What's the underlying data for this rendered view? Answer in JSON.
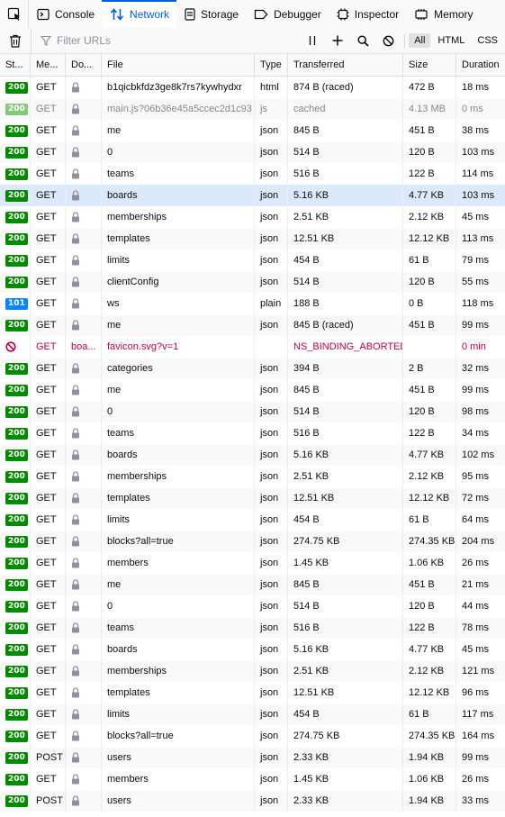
{
  "tabs": [
    {
      "label": "Console",
      "icon": "console-icon"
    },
    {
      "label": "Network",
      "icon": "network-icon",
      "active": true
    },
    {
      "label": "Storage",
      "icon": "storage-icon"
    },
    {
      "label": "Debugger",
      "icon": "debugger-icon"
    },
    {
      "label": "Inspector",
      "icon": "inspector-icon"
    },
    {
      "label": "Memory",
      "icon": "memory-icon"
    }
  ],
  "toolbar": {
    "filter_placeholder": "Filter URLs",
    "filter_types": [
      "All",
      "HTML",
      "CSS"
    ],
    "active_filter": "All"
  },
  "columns": [
    "St...",
    "Me...",
    "Do...",
    "File",
    "Type",
    "Transferred",
    "Size",
    "Duration"
  ],
  "requests": [
    {
      "status": "200",
      "method": "GET",
      "domain": "",
      "file": "b1qicbkfdz3ge8k7rs7kywhydxr",
      "type": "html",
      "transferred": "874 B (raced)",
      "size": "472 B",
      "duration": "18 ms"
    },
    {
      "status": "200",
      "method": "GET",
      "domain": "",
      "file": "main.js?06b36e45a5ccec2d1c93",
      "type": "js",
      "transferred": "cached",
      "size": "4.13 MB",
      "duration": "0 ms",
      "cached": true
    },
    {
      "status": "200",
      "method": "GET",
      "domain": "",
      "file": "me",
      "type": "json",
      "transferred": "845 B",
      "size": "451 B",
      "duration": "38 ms"
    },
    {
      "status": "200",
      "method": "GET",
      "domain": "",
      "file": "0",
      "type": "json",
      "transferred": "514 B",
      "size": "120 B",
      "duration": "103 ms"
    },
    {
      "status": "200",
      "method": "GET",
      "domain": "",
      "file": "teams",
      "type": "json",
      "transferred": "516 B",
      "size": "122 B",
      "duration": "114 ms"
    },
    {
      "status": "200",
      "method": "GET",
      "domain": "",
      "file": "boards",
      "type": "json",
      "transferred": "5.16 KB",
      "size": "4.77 KB",
      "duration": "103 ms",
      "selected": true
    },
    {
      "status": "200",
      "method": "GET",
      "domain": "",
      "file": "memberships",
      "type": "json",
      "transferred": "2.51 KB",
      "size": "2.12 KB",
      "duration": "45 ms"
    },
    {
      "status": "200",
      "method": "GET",
      "domain": "",
      "file": "templates",
      "type": "json",
      "transferred": "12.51 KB",
      "size": "12.12 KB",
      "duration": "113 ms"
    },
    {
      "status": "200",
      "method": "GET",
      "domain": "",
      "file": "limits",
      "type": "json",
      "transferred": "454 B",
      "size": "61 B",
      "duration": "79 ms"
    },
    {
      "status": "200",
      "method": "GET",
      "domain": "",
      "file": "clientConfig",
      "type": "json",
      "transferred": "514 B",
      "size": "120 B",
      "duration": "55 ms"
    },
    {
      "status": "101",
      "method": "GET",
      "domain": "",
      "file": "ws",
      "type": "plain",
      "transferred": "188 B",
      "size": "0 B",
      "duration": "118 ms"
    },
    {
      "status": "200",
      "method": "GET",
      "domain": "",
      "file": "me",
      "type": "json",
      "transferred": "845 B (raced)",
      "size": "451 B",
      "duration": "99 ms"
    },
    {
      "status": "blocked",
      "method": "GET",
      "domain": "boa...",
      "file": "favicon.svg?v=1",
      "type": "",
      "transferred": "NS_BINDING_ABORTED",
      "size": "",
      "duration": "0 min",
      "error": true
    },
    {
      "status": "200",
      "method": "GET",
      "domain": "",
      "file": "categories",
      "type": "json",
      "transferred": "394 B",
      "size": "2 B",
      "duration": "32 ms"
    },
    {
      "status": "200",
      "method": "GET",
      "domain": "",
      "file": "me",
      "type": "json",
      "transferred": "845 B",
      "size": "451 B",
      "duration": "99 ms"
    },
    {
      "status": "200",
      "method": "GET",
      "domain": "",
      "file": "0",
      "type": "json",
      "transferred": "514 B",
      "size": "120 B",
      "duration": "98 ms"
    },
    {
      "status": "200",
      "method": "GET",
      "domain": "",
      "file": "teams",
      "type": "json",
      "transferred": "516 B",
      "size": "122 B",
      "duration": "34 ms"
    },
    {
      "status": "200",
      "method": "GET",
      "domain": "",
      "file": "boards",
      "type": "json",
      "transferred": "5.16 KB",
      "size": "4.77 KB",
      "duration": "102 ms"
    },
    {
      "status": "200",
      "method": "GET",
      "domain": "",
      "file": "memberships",
      "type": "json",
      "transferred": "2.51 KB",
      "size": "2.12 KB",
      "duration": "95 ms"
    },
    {
      "status": "200",
      "method": "GET",
      "domain": "",
      "file": "templates",
      "type": "json",
      "transferred": "12.51 KB",
      "size": "12.12 KB",
      "duration": "72 ms"
    },
    {
      "status": "200",
      "method": "GET",
      "domain": "",
      "file": "limits",
      "type": "json",
      "transferred": "454 B",
      "size": "61 B",
      "duration": "64 ms"
    },
    {
      "status": "200",
      "method": "GET",
      "domain": "",
      "file": "blocks?all=true",
      "type": "json",
      "transferred": "274.75 KB",
      "size": "274.35 KB",
      "duration": "204 ms"
    },
    {
      "status": "200",
      "method": "GET",
      "domain": "",
      "file": "members",
      "type": "json",
      "transferred": "1.45 KB",
      "size": "1.06 KB",
      "duration": "26 ms"
    },
    {
      "status": "200",
      "method": "GET",
      "domain": "",
      "file": "me",
      "type": "json",
      "transferred": "845 B",
      "size": "451 B",
      "duration": "21 ms"
    },
    {
      "status": "200",
      "method": "GET",
      "domain": "",
      "file": "0",
      "type": "json",
      "transferred": "514 B",
      "size": "120 B",
      "duration": "44 ms"
    },
    {
      "status": "200",
      "method": "GET",
      "domain": "",
      "file": "teams",
      "type": "json",
      "transferred": "516 B",
      "size": "122 B",
      "duration": "78 ms"
    },
    {
      "status": "200",
      "method": "GET",
      "domain": "",
      "file": "boards",
      "type": "json",
      "transferred": "5.16 KB",
      "size": "4.77 KB",
      "duration": "45 ms"
    },
    {
      "status": "200",
      "method": "GET",
      "domain": "",
      "file": "memberships",
      "type": "json",
      "transferred": "2.51 KB",
      "size": "2.12 KB",
      "duration": "121 ms"
    },
    {
      "status": "200",
      "method": "GET",
      "domain": "",
      "file": "templates",
      "type": "json",
      "transferred": "12.51 KB",
      "size": "12.12 KB",
      "duration": "96 ms"
    },
    {
      "status": "200",
      "method": "GET",
      "domain": "",
      "file": "limits",
      "type": "json",
      "transferred": "454 B",
      "size": "61 B",
      "duration": "117 ms"
    },
    {
      "status": "200",
      "method": "GET",
      "domain": "",
      "file": "blocks?all=true",
      "type": "json",
      "transferred": "274.75 KB",
      "size": "274.35 KB",
      "duration": "164 ms"
    },
    {
      "status": "200",
      "method": "POST",
      "domain": "",
      "file": "users",
      "type": "json",
      "transferred": "2.33 KB",
      "size": "1.94 KB",
      "duration": "99 ms"
    },
    {
      "status": "200",
      "method": "GET",
      "domain": "",
      "file": "members",
      "type": "json",
      "transferred": "1.45 KB",
      "size": "1.06 KB",
      "duration": "26 ms"
    },
    {
      "status": "200",
      "method": "POST",
      "domain": "",
      "file": "users",
      "type": "json",
      "transferred": "2.33 KB",
      "size": "1.94 KB",
      "duration": "33 ms"
    }
  ],
  "colors": {
    "accent": "#0060df",
    "status_ok": "#058b00",
    "status_cached": "#85c77e",
    "status_switch": "#0a84ff",
    "error": "#c2003b",
    "selected_row": "#dce9fb"
  }
}
